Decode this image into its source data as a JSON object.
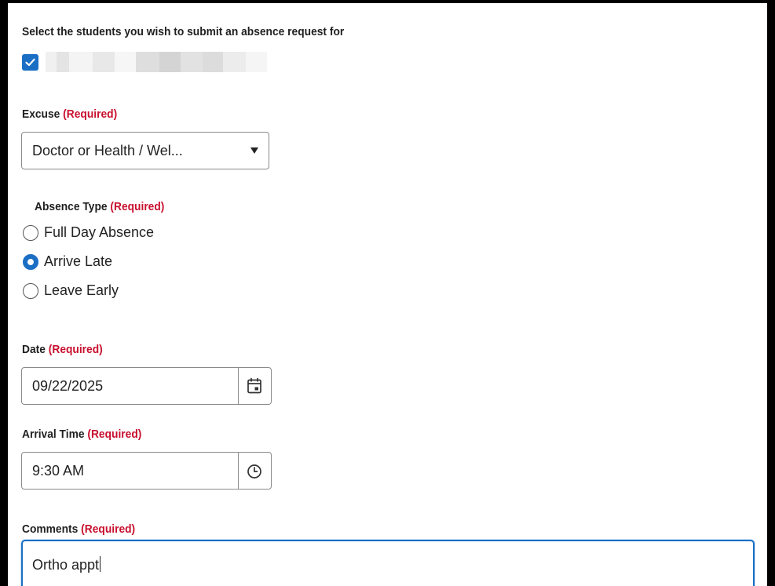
{
  "students": {
    "heading": "Select the students you wish to submit an absence request for",
    "student_checked": true
  },
  "excuse": {
    "label": "Excuse",
    "required": "(Required)",
    "selected_value": "Doctor or Health / Wel..."
  },
  "absence_type": {
    "label": "Absence Type",
    "required": "(Required)",
    "options": [
      {
        "label": "Full Day Absence",
        "checked": false
      },
      {
        "label": "Arrive Late",
        "checked": true
      },
      {
        "label": "Leave Early",
        "checked": false
      }
    ]
  },
  "date": {
    "label": "Date",
    "required": "(Required)",
    "value": "09/22/2025",
    "icon": "calendar-icon"
  },
  "arrival_time": {
    "label": "Arrival Time",
    "required": "(Required)",
    "value": "9:30 AM",
    "icon": "clock-icon"
  },
  "comments": {
    "label": "Comments",
    "required": "(Required)",
    "value": "Ortho appt"
  },
  "colors": {
    "accent": "#1a6fc4",
    "required": "#c8102e"
  }
}
